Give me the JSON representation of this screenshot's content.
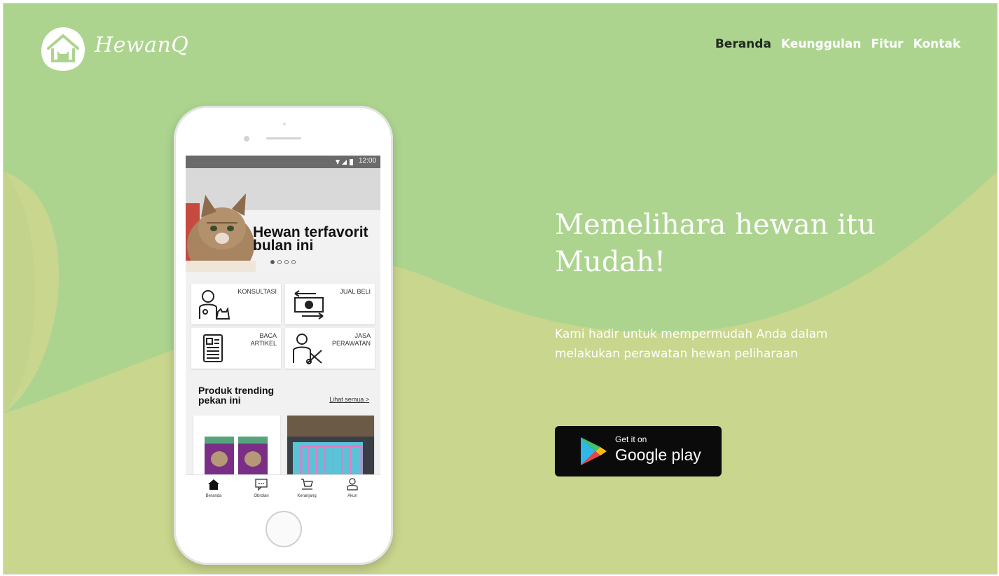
{
  "brand": {
    "name": "HewanQ",
    "logo_icon": "house-cat-icon"
  },
  "nav": {
    "items": [
      {
        "label": "Beranda",
        "active": true
      },
      {
        "label": "Keunggulan",
        "active": false
      },
      {
        "label": "Fitur",
        "active": false
      },
      {
        "label": "Kontak",
        "active": false
      }
    ]
  },
  "hero": {
    "title_lines": [
      "Memelihara hewan itu",
      "Mudah!"
    ],
    "subtitle_lines": [
      "Kami hadir untuk mempermudah Anda dalam",
      "melakukan perawatan hewan peliharaan"
    ],
    "store_badge": {
      "small": "Get it on",
      "big": "Google play",
      "icon": "google-play-icon"
    }
  },
  "phone": {
    "status_time": "12:00",
    "banner": {
      "title_lines": [
        "Hewan terfavorit",
        "bulan ini"
      ],
      "slide_count": 4,
      "active_slide": 0
    },
    "menu": [
      {
        "label_lines": [
          "KONSULTASI"
        ],
        "icon": "vet-consult-icon"
      },
      {
        "label_lines": [
          "JUAL BELI"
        ],
        "icon": "money-exchange-icon"
      },
      {
        "label_lines": [
          "BACA",
          "ARTIKEL"
        ],
        "icon": "article-icon"
      },
      {
        "label_lines": [
          "JASA",
          "PERAWATAN"
        ],
        "icon": "grooming-icon"
      }
    ],
    "trending": {
      "title_lines": [
        "Produk trending",
        "pekan ini"
      ],
      "see_all": "Lihat semua >"
    },
    "bottom_nav": [
      {
        "label": "Beranda",
        "icon": "home-icon"
      },
      {
        "label": "Obrolan",
        "icon": "chat-icon"
      },
      {
        "label": "Keranjang",
        "icon": "cart-icon"
      },
      {
        "label": "Akun",
        "icon": "user-icon"
      }
    ]
  },
  "colors": {
    "bg_green": "#acd48f",
    "wave_green": "#c9d68d",
    "dark": "#0b0b0b",
    "white": "#ffffff"
  }
}
